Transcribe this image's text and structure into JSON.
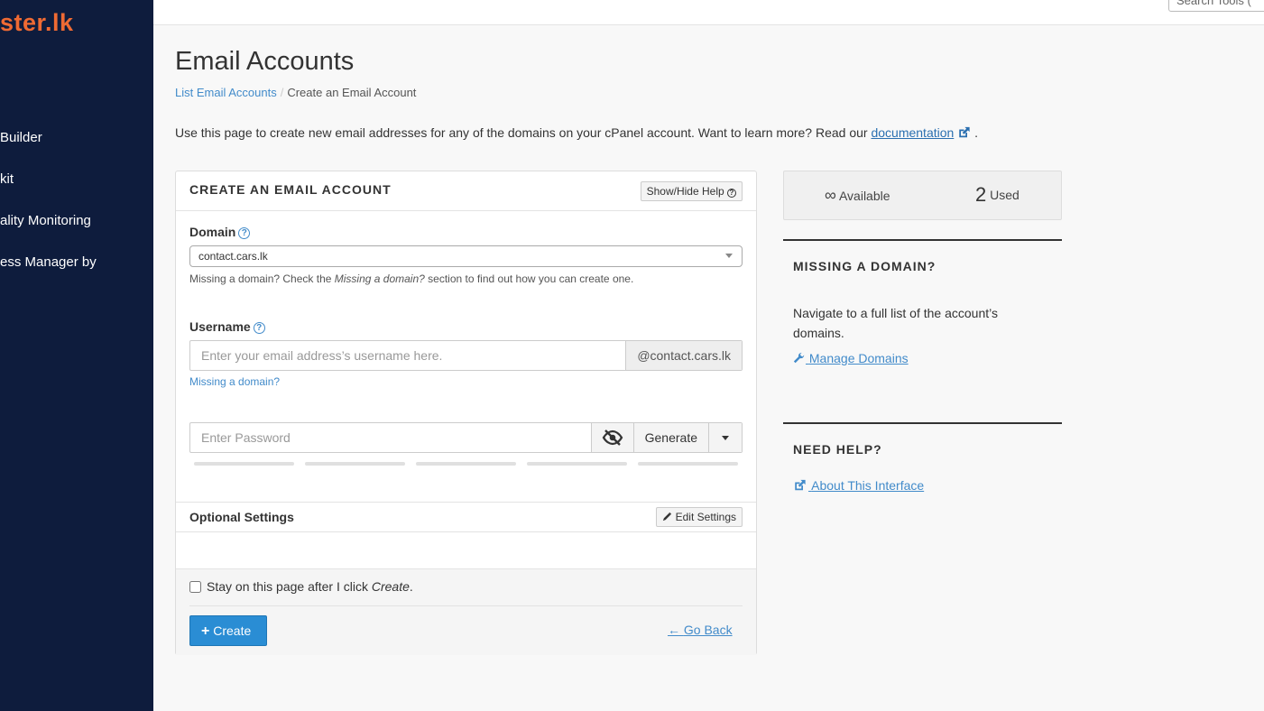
{
  "sidebar": {
    "brand": "ster.lk",
    "items": [
      {
        "label": "Builder"
      },
      {
        "label": "kit"
      },
      {
        "label": "ality Monitoring"
      },
      {
        "label": "ess Manager by"
      }
    ]
  },
  "header": {
    "search_placeholder": "Search Tools ("
  },
  "page": {
    "title": "Email Accounts",
    "breadcrumb": {
      "parent": "List Email Accounts",
      "separator": "/",
      "current": "Create an Email Account"
    },
    "intro": {
      "text": "Use this page to create new email addresses for any of the domains on your cPanel account. Want to learn more? Read our ",
      "link": "documentation",
      "suffix": " ."
    }
  },
  "form": {
    "title": "CREATE AN EMAIL ACCOUNT",
    "help_toggle": "Show/Hide Help",
    "domain": {
      "label": "Domain",
      "selected": "contact.cars.lk",
      "hint_prefix": "Missing a domain? Check the ",
      "hint_em": "Missing a domain?",
      "hint_suffix": " section to find out how you can create one."
    },
    "username": {
      "label": "Username",
      "placeholder": "Enter your email address’s username here.",
      "suffix": "@contact.cars.lk",
      "missing_link": "Missing a domain?"
    },
    "password": {
      "placeholder": "Enter Password",
      "generate": "Generate"
    },
    "optional": {
      "label": "Optional Settings",
      "edit": "Edit Settings"
    },
    "stay": {
      "prefix": "Stay on this page after I click ",
      "em": "Create",
      "suffix": ".",
      "checked": false
    },
    "create_label": "Create",
    "go_back": "Go Back"
  },
  "stats": {
    "available_value": "∞",
    "available_label": "Available",
    "used_value": "2",
    "used_label": "Used"
  },
  "missing_domain": {
    "title": "MISSING A DOMAIN?",
    "text": "Navigate to a full list of the account’s domains.",
    "link": "Manage Domains"
  },
  "need_help": {
    "title": "NEED HELP?",
    "link": "About This Interface"
  },
  "colors": {
    "sidebar_bg": "#0e1c3d",
    "brand": "#ef6a33",
    "link": "#428bca",
    "primary_button": "#2a8dd4"
  }
}
